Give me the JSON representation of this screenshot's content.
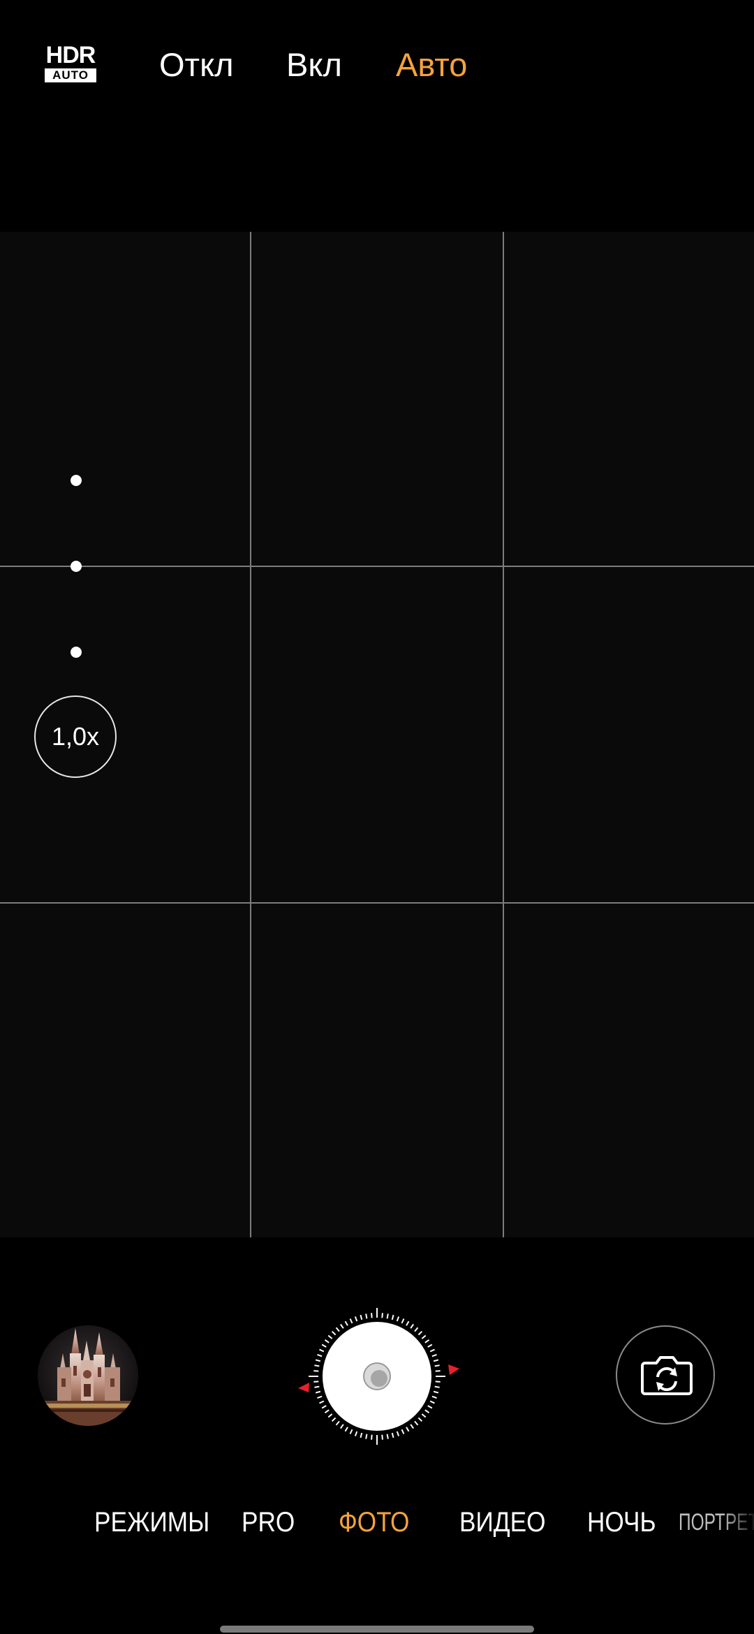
{
  "hdr": {
    "icon_main": "HDR",
    "icon_sub": "AUTO",
    "options": [
      {
        "label": "Откл",
        "active": false
      },
      {
        "label": "Вкл",
        "active": false
      },
      {
        "label": "Авто",
        "active": true
      }
    ]
  },
  "viewfinder": {
    "zoom_label": "1,0x",
    "grid": "3x3"
  },
  "controls": {
    "gallery_icon": "gallery-thumbnail",
    "shutter_icon": "shutter-button",
    "switch_icon": "switch-camera-icon"
  },
  "modes": [
    {
      "label": "РЕЖИМЫ",
      "active": false
    },
    {
      "label": "PRO",
      "active": false
    },
    {
      "label": "ФОТО",
      "active": true
    },
    {
      "label": "ВИДЕО",
      "active": false
    },
    {
      "label": "НОЧЬ",
      "active": false
    },
    {
      "label": "ПОРТРЕТ",
      "active": false
    }
  ],
  "colors": {
    "accent": "#f5a33b",
    "shutter_marker": "#e8202a"
  }
}
